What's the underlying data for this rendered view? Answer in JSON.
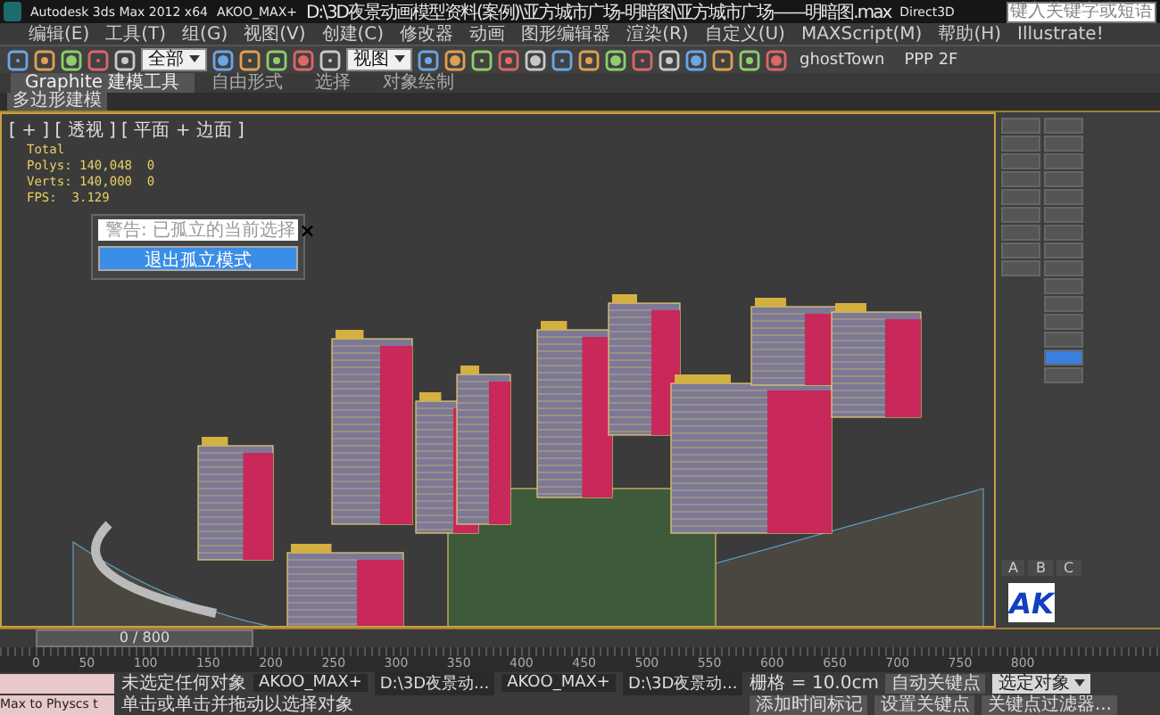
{
  "title_bar": {
    "app": "Autodesk 3ds Max 2012 x64",
    "plugin": "AKOO_MAX+",
    "file": "D:\\3D夜景动画模型资料(案例)\\亚方城市广场-明暗图\\亚方城市广场——明暗图.max",
    "renderer": "Direct3D",
    "search": {
      "placeholder": "键入关键字或短语"
    }
  },
  "menu": [
    "编辑(E)",
    "工具(T)",
    "组(G)",
    "视图(V)",
    "创建(C)",
    "修改器",
    "动画",
    "图形编辑器",
    "渲染(R)",
    "自定义(U)",
    "MAXScript(M)",
    "帮助(H)",
    "Illustrate!"
  ],
  "toolbar": {
    "selection_filter": "全部",
    "reference_coord": "视图",
    "named_set": "ghostTown",
    "layer": "PPP 2F"
  },
  "ribbon_tabs": [
    {
      "label": "Graphite 建模工具",
      "selected": true
    },
    {
      "label": "自由形式",
      "selected": false
    },
    {
      "label": "选择",
      "selected": false
    },
    {
      "label": "对象绘制",
      "selected": false
    }
  ],
  "ribbon_panel": "多边形建模",
  "viewport": {
    "label": "[ + ] [ 透视 ] [ 平面 + 边面 ]",
    "stats": [
      "Total",
      "Polys: 140,048  0",
      "Verts: 140,000  0",
      "FPS:  3.129"
    ],
    "dialog": {
      "title": "警告: 已孤立的当前选择",
      "close": "×",
      "button": "退出孤立模式"
    }
  },
  "command_panel": {
    "rows": [
      {
        "selected": false
      },
      {
        "selected": false
      },
      {
        "selected": false
      },
      {
        "selected": false
      },
      {
        "selected": false
      },
      {
        "selected": false
      },
      {
        "selected": false
      },
      {
        "selected": false
      },
      {
        "selected": false
      },
      {
        "selected": false
      },
      {
        "selected": false
      },
      {
        "selected": false
      },
      {
        "selected": false
      },
      {
        "selected": true
      },
      {
        "selected": false
      }
    ],
    "tabs": [
      "A",
      "B",
      "C"
    ],
    "logo": "AK"
  },
  "time_slider": "0 / 800",
  "ruler": [
    "0",
    "50",
    "100",
    "150",
    "200",
    "250",
    "300",
    "350",
    "400",
    "450",
    "500",
    "550",
    "600",
    "650",
    "700",
    "750",
    "800"
  ],
  "status": {
    "listener": "Max to Physcs t",
    "selection": "未选定任何对象",
    "prompt": "单击或单击并拖动以选择对象",
    "taskbar": [
      "AKOO_MAX+",
      "D:\\3D夜景动...",
      "AKOO_MAX+",
      "D:\\3D夜景动..."
    ],
    "grid": "栅格 = 10.0cm",
    "time_tag": "添加时间标记",
    "auto_key": "自动关键点",
    "key_mode": "选定对象",
    "set_key": "设置关键点",
    "key_filters": "关键点过滤器..."
  }
}
